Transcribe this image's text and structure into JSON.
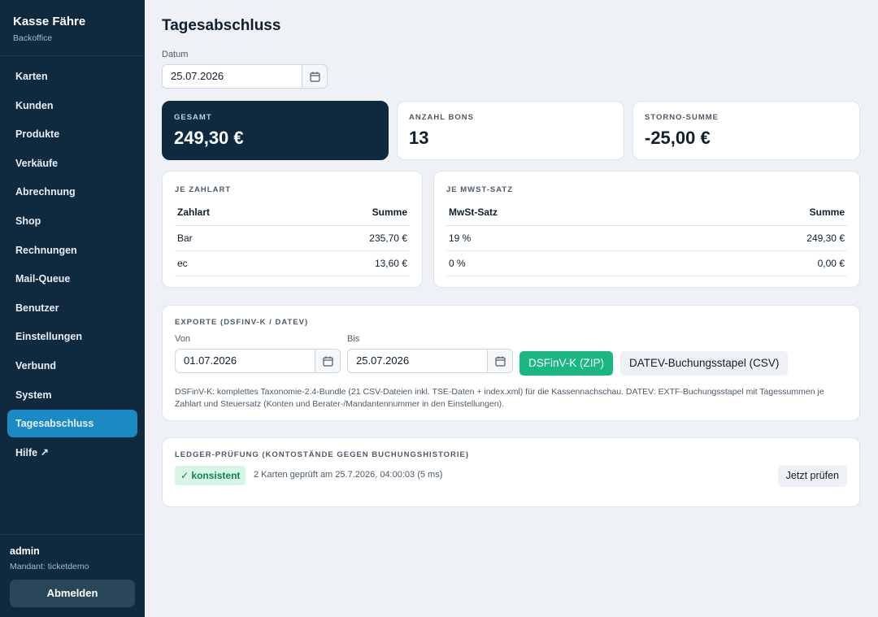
{
  "sidebar": {
    "brand_title": "Kasse Fähre",
    "brand_subtitle": "Backoffice",
    "items": [
      {
        "label": "Karten"
      },
      {
        "label": "Kunden"
      },
      {
        "label": "Produkte"
      },
      {
        "label": "Verkäufe"
      },
      {
        "label": "Abrechnung"
      },
      {
        "label": "Shop"
      },
      {
        "label": "Rechnungen"
      },
      {
        "label": "Mail-Queue"
      },
      {
        "label": "Benutzer"
      },
      {
        "label": "Einstellungen"
      },
      {
        "label": "Verbund"
      },
      {
        "label": "System"
      },
      {
        "label": "Tagesabschluss"
      },
      {
        "label": "Hilfe ↗"
      }
    ],
    "active_item": "Tagesabschluss",
    "user": "admin",
    "mandant": "Mandant: ticketdemo",
    "logout_label": "Abmelden"
  },
  "main": {
    "title": "Tagesabschluss",
    "date_label": "Datum",
    "date_value": "25.07.2026",
    "stats": {
      "total_label": "GESAMT",
      "total_value": "249,30 €",
      "bons_label": "ANZAHL BONS",
      "bons_value": "13",
      "storno_label": "STORNO-SUMME",
      "storno_value": "-25,00 €"
    },
    "payment": {
      "title": "JE ZAHLART",
      "col1": "Zahlart",
      "col2": "Summe",
      "rows": [
        {
          "name": "Bar",
          "sum": "235,70 €"
        },
        {
          "name": "ec",
          "sum": "13,60 €"
        }
      ]
    },
    "vat": {
      "title": "JE MWST-SATZ",
      "col1": "MwSt-Satz",
      "col2": "Summe",
      "rows": [
        {
          "name": "19 %",
          "sum": "249,30 €"
        },
        {
          "name": "0 %",
          "sum": "0,00 €"
        }
      ]
    },
    "exports": {
      "title": "EXPORTE (DSFINV-K / DATEV)",
      "from_label": "Von",
      "from_value": "01.07.2026",
      "to_label": "Bis",
      "to_value": "25.07.2026",
      "dsfinv_button": "DSFinV-K (ZIP)",
      "datev_button": "DATEV-Buchungsstapel (CSV)",
      "description": "DSFinV-K: komplettes Taxonomie-2.4-Bundle (21 CSV-Dateien inkl. TSE-Daten + index.xml) für die Kassennachschau. DATEV: EXTF-Buchungsstapel mit Tagessummen je Zahlart und Steuersatz (Konten und Berater-/Mandantennummer in den Einstellungen)."
    },
    "ledger": {
      "title": "LEDGER-PRÜFUNG (KONTOSTÄNDE GEGEN BUCHUNGSHISTORIE)",
      "status": "✓ konsistent",
      "info": "2 Karten geprüft am 25.7.2026, 04:00:03 (5 ms)",
      "check_button": "Jetzt prüfen"
    }
  },
  "colors": {
    "sidebar_bg": "#0f2a3f",
    "active_nav": "#1a8ac5",
    "accent_green": "#1ab784",
    "badge_bg": "#d8f6e6"
  }
}
